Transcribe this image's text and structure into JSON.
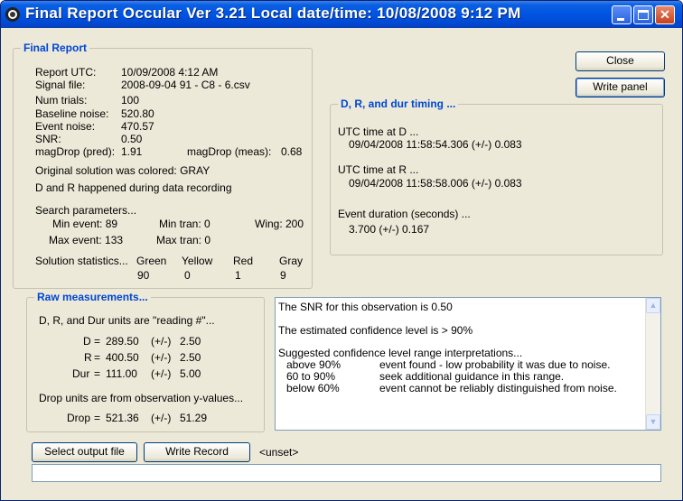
{
  "window": {
    "title": "Final Report Occular Ver 3.21  Local date/time:  10/08/2008  9:12 PM",
    "min_label": "",
    "max_label": "",
    "close_label": "✕"
  },
  "buttons": {
    "close": "Close",
    "write_panel": "Write panel",
    "select_output": "Select output file",
    "write_record": "Write Record"
  },
  "output_path": "<unset>",
  "status_value": "",
  "final_report": {
    "label": "Final Report",
    "report_utc_label": "Report UTC:",
    "report_utc": "10/09/2008 4:12 AM",
    "signal_file_label": "Signal file:",
    "signal_file": "2008-09-04 91 - C8 - 6.csv",
    "num_trials_label": "Num trials:",
    "num_trials": "100",
    "baseline_noise_label": "Baseline noise:",
    "baseline_noise": "520.80",
    "event_noise_label": "Event noise:",
    "event_noise": "470.57",
    "snr_label": "SNR:",
    "snr": "0.50",
    "magdrop_pred_label": "magDrop (pred):",
    "magdrop_pred": "1.91",
    "magdrop_meas_label": "magDrop (meas):",
    "magdrop_meas": "0.68",
    "color_line": "Original solution was colored:  GRAY",
    "recording_line": "D and R happened during data recording",
    "search_params": "Search parameters...",
    "min_event": "Min event: 89",
    "min_tran": "Min tran: 0",
    "wing": "Wing: 200",
    "max_event": "Max event: 133",
    "max_tran": "Max tran: 0",
    "solution_stats": "Solution statistics...",
    "stats": [
      {
        "name": "Green",
        "count": "90"
      },
      {
        "name": "Yellow",
        "count": "0"
      },
      {
        "name": "Red",
        "count": "1"
      },
      {
        "name": "Gray",
        "count": "9"
      }
    ]
  },
  "timing": {
    "label": "D, R, and dur timing ...",
    "d_header": "UTC time at D ...",
    "d_value": "09/04/2008 11:58:54.306  (+/-)  0.083",
    "r_header": "UTC time at R ...",
    "r_value": "09/04/2008 11:58:58.006  (+/-)  0.083",
    "dur_header": "Event duration (seconds) ...",
    "dur_value": "3.700  (+/-)  0.167"
  },
  "raw": {
    "label": "Raw measurements...",
    "units_line": "D, R, and Dur units are \"reading #\"...",
    "pm": "(+/-)",
    "rows": [
      {
        "name": "D",
        "value": "289.50",
        "err": "2.50"
      },
      {
        "name": "R",
        "value": "400.50",
        "err": "2.50"
      },
      {
        "name": "Dur",
        "value": "111.00",
        "err": "5.00"
      }
    ],
    "drop_units": "Drop units are from observation y-values...",
    "drop_name": "Drop",
    "drop_value": "521.36",
    "drop_err": "51.29"
  },
  "notes": {
    "snr_line": "The SNR for this observation is 0.50",
    "confidence_line": "The estimated confidence level is > 90%",
    "ranges_header": "Suggested confidence level range interpretations...",
    "ranges": [
      {
        "range": "above 90%",
        "meaning": "event found - low probability it was due to noise."
      },
      {
        "range": "60 to 90%",
        "meaning": "seek additional guidance in this range."
      },
      {
        "range": "below 60%",
        "meaning": "event cannot be reliably distinguished from noise."
      }
    ]
  }
}
